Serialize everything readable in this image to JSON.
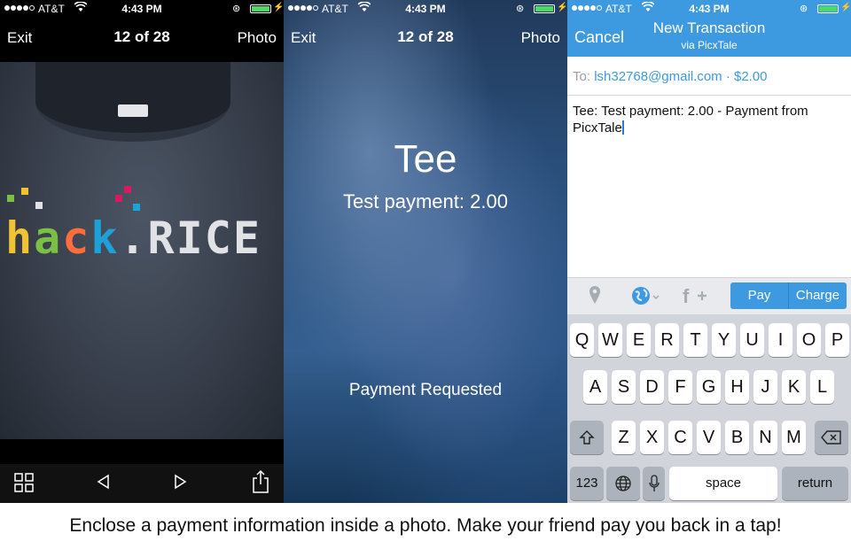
{
  "status": {
    "carrier": "AT&T",
    "time": "4:43 PM"
  },
  "screen1": {
    "nav": {
      "left": "Exit",
      "center": "12 of 28",
      "right": "Photo"
    },
    "shirt_print": "hack.RICE",
    "toolbar_icons": [
      "grid-icon",
      "previous-icon",
      "next-icon",
      "share-icon"
    ]
  },
  "screen2": {
    "nav": {
      "left": "Exit",
      "center": "12 of 28",
      "right": "Photo"
    },
    "title": "Tee",
    "subtitle": "Test payment: 2.00",
    "status": "Payment Requested"
  },
  "screen3": {
    "nav": {
      "left": "Cancel",
      "title": "New Transaction",
      "subtitle": "via PicxTale"
    },
    "to_label": "To:",
    "to_value": "lsh32768@gmail.com · $2.00",
    "message": "Tee: Test payment: 2.00 -  Payment from PicxTale",
    "segments": [
      "Pay",
      "Charge"
    ],
    "keyboard": {
      "row1": [
        "Q",
        "W",
        "E",
        "R",
        "T",
        "Y",
        "U",
        "I",
        "O",
        "P"
      ],
      "row2": [
        "A",
        "S",
        "D",
        "F",
        "G",
        "H",
        "J",
        "K",
        "L"
      ],
      "row3": [
        "Z",
        "X",
        "C",
        "V",
        "B",
        "N",
        "M"
      ],
      "num": "123",
      "space": "space",
      "return": "return"
    }
  },
  "caption": "Enclose a payment information inside a photo. Make your friend pay you back in a tap!",
  "colors": {
    "accent": "#3d9ae0",
    "battery": "#4cd964"
  }
}
